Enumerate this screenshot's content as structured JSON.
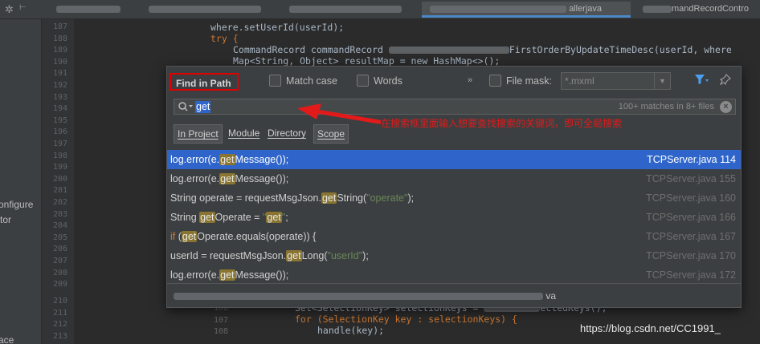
{
  "editor": {
    "line_numbers": [
      "187",
      "188",
      "189",
      "190",
      "191",
      "192",
      "193",
      "194",
      "195",
      "196",
      "197",
      "198",
      "199",
      "200",
      "201",
      "202",
      "203",
      "204",
      "205",
      "206",
      "207",
      "208",
      "209",
      "210",
      "211",
      "212",
      "213"
    ],
    "bottom_line_numbers": [
      "106",
      "107",
      "108"
    ],
    "code_top": [
      "where.setUserId(userId);",
      "try {",
      "CommandRecord commandRecord",
      "FirstOrderByUpdateTimeDesc(userId, where",
      "Map<String, Object> resultMap = new HashMap<>();"
    ],
    "code_bottom": [
      "Set<SelectionKey> selectionKeys =",
      "ectedKeys();",
      "for (SelectionKey key : selectionKeys) {",
      "handle(key);"
    ]
  },
  "project_panel": {
    "items": [
      "onfigure",
      "tor",
      "ace"
    ]
  },
  "tabs": [
    "allerjava",
    "mandRecordContro"
  ],
  "dialog": {
    "title": "Find in Path",
    "match_case": "Match case",
    "words": "Words",
    "more": "»",
    "file_mask_label": "File mask:",
    "file_mask_value": "*.mxml",
    "search_query": "get",
    "match_count": "100+ matches in 8+ files",
    "scopes": [
      "In Project",
      "Module",
      "Directory",
      "Scope"
    ],
    "footer_path_tail": "va",
    "results": [
      {
        "pre": "log.error(e.",
        "hl": "get",
        "post": "Message());",
        "file": "TCPServer.java 114"
      },
      {
        "pre": "log.error(e.",
        "hl": "get",
        "post": "Message());",
        "file": "TCPServer.java 155"
      },
      {
        "pre": "String operate = requestMsgJson.",
        "hl": "get",
        "post": "String(",
        "str": "\"operate\"",
        "tail": ");",
        "file": "TCPServer.java 160"
      },
      {
        "pre": "String ",
        "hl": "get",
        "post": "Operate = ",
        "str": "\"",
        "hl2": "get",
        "str2": "\"",
        "tail": ";",
        "file": "TCPServer.java 166"
      },
      {
        "kw": "if",
        "pre": " (",
        "hl": "get",
        "post": "Operate.equals(operate)) {",
        "file": "TCPServer.java 167"
      },
      {
        "pre": "userId = requestMsgJson.",
        "hl": "get",
        "post": "Long(",
        "str": "\"userId\"",
        "tail": ");",
        "file": "TCPServer.java 170"
      },
      {
        "pre": "log.error(e.",
        "hl": "get",
        "post": "Message());",
        "file": "TCPServer.java 172"
      }
    ]
  },
  "annotation": "在搜索框里面输入想要查找搜索的关键词，即可全局搜索",
  "watermark": "https://blog.csdn.net/CC1991_",
  "colors": {
    "accent": "#2f65ca",
    "highlight": "#8a7530",
    "annotation": "#e21a1a"
  }
}
